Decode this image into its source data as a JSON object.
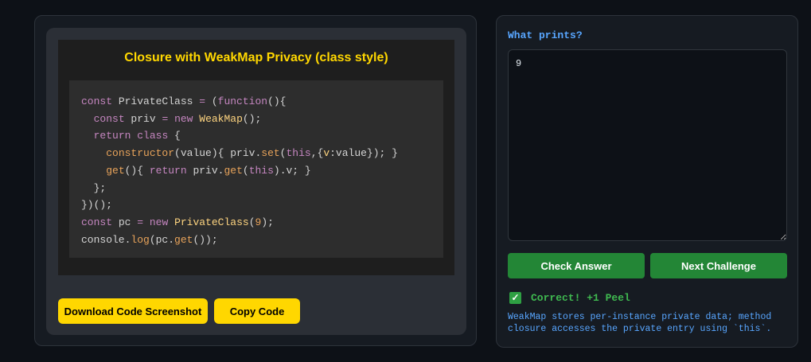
{
  "challenge": {
    "title": "Closure with WeakMap Privacy (class style)",
    "code_lines": [
      "const PrivateClass = (function(){",
      "  const priv = new WeakMap();",
      "  return class {",
      "    constructor(value){ priv.set(this,{v:value}); }",
      "    get(){ return priv.get(this).v; }",
      "  };",
      "})();",
      "const pc = new PrivateClass(9);",
      "console.log(pc.get());"
    ],
    "download_button": "Download Code Screenshot",
    "copy_button": "Copy Code"
  },
  "answer_panel": {
    "prompt": "What prints?",
    "answer_value": "9",
    "check_button": "Check Answer",
    "next_button": "Next Challenge",
    "result_text": "Correct! +1 Peel",
    "result_icon": "checkmark-icon",
    "explanation": "WeakMap stores per-instance private data; method closure accesses the private entry using `this`."
  },
  "colors": {
    "accent_yellow": "#ffd700",
    "accent_green": "#238636",
    "accent_blue": "#58a6ff",
    "success_green": "#3fb950"
  }
}
